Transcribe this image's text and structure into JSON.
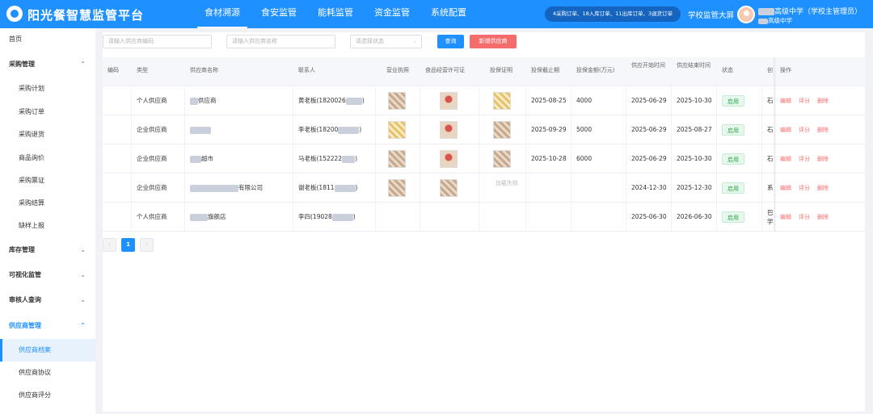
{
  "header": {
    "title": "阳光餐智慧监管平台",
    "nav": [
      "食材溯源",
      "食安监管",
      "能耗监管",
      "资金监管",
      "系统配置"
    ],
    "active_nav": 0,
    "stats": "4采购订单、18入库订单、11出库订单、3退货订单",
    "big_screen": "学校监管大屏",
    "user_line1": "高级中学（学校主管理员）",
    "user_line2": "高级中学"
  },
  "sidebar": {
    "home": "首页",
    "groups": [
      {
        "label": "采购管理",
        "expanded": true,
        "items": [
          "采购计划",
          "采购订单",
          "采购退货",
          "商品询价",
          "采购票证",
          "采购结算",
          "缺样上报"
        ]
      },
      {
        "label": "库存管理",
        "expanded": false,
        "items": []
      },
      {
        "label": "可视化监管",
        "expanded": false,
        "items": []
      },
      {
        "label": "审核人查询",
        "expanded": false,
        "items": []
      },
      {
        "label": "供应商管理",
        "expanded": true,
        "items": [
          "供应商档案",
          "供应商协议",
          "供应商评分"
        ]
      }
    ],
    "active_item": "供应商档案"
  },
  "filters": {
    "code_placeholder": "请输入供应商编码",
    "name_placeholder": "请输入供应商名称",
    "status_placeholder": "请选择状态",
    "query_label": "查询",
    "add_label": "新增供应商"
  },
  "table": {
    "columns": [
      "编码",
      "类型",
      "供应商名称",
      "联系人",
      "营业执照",
      "食品经营许可证",
      "投保证明",
      "投保截止期",
      "投保金额(万元)",
      "供应开始时间",
      "供应结束时间",
      "状态",
      "创",
      "操作"
    ],
    "rows": [
      {
        "type": "个人供应商",
        "name": "供应商",
        "contact": "黄老板(1820026",
        "contact_tail": ")",
        "license": "pic",
        "food_permit": "pic-red",
        "insurance": "pic-gold",
        "ins_deadline": "2025-08-25",
        "ins_amount": "4000",
        "start": "2025-06-29",
        "end": "2025-10-30",
        "status": "启用",
        "creator": "石"
      },
      {
        "type": "企业供应商",
        "name": "",
        "contact": "李老板(18200",
        "contact_tail": ")",
        "license": "pic-gold",
        "food_permit": "pic-red",
        "insurance": "pic",
        "ins_deadline": "2025-09-29",
        "ins_amount": "5000",
        "start": "2025-06-29",
        "end": "2025-08-27",
        "status": "启用",
        "creator": "石"
      },
      {
        "type": "企业供应商",
        "name": "超市",
        "contact": "马老板(152222",
        "contact_tail": ")",
        "license": "pic",
        "food_permit": "pic-red",
        "insurance": "pic",
        "ins_deadline": "2025-10-28",
        "ins_amount": "6000",
        "start": "2025-06-29",
        "end": "2025-10-30",
        "status": "启用",
        "creator": "石"
      },
      {
        "type": "企业供应商",
        "name": "有限公司",
        "contact": "谢老板(1811",
        "contact_tail": ")",
        "license": "pic",
        "food_permit": "pic",
        "insurance": "fail",
        "ins_fail_text": "加载失败",
        "ins_deadline": "",
        "ins_amount": "",
        "start": "2024-12-30",
        "end": "2025-12-30",
        "status": "启用",
        "creator": "系"
      },
      {
        "type": "个人供应商",
        "name": "旗舰店",
        "contact": "李四(19028",
        "contact_tail": ")",
        "license": "",
        "food_permit": "",
        "insurance": "",
        "ins_deadline": "",
        "ins_amount": "",
        "start": "2025-06-30",
        "end": "2026-06-30",
        "status": "启用",
        "creator": "巴学"
      }
    ],
    "ops": [
      "编辑",
      "评分",
      "删除"
    ]
  },
  "pagination": {
    "prev": "‹",
    "current": "1",
    "next": "›"
  }
}
